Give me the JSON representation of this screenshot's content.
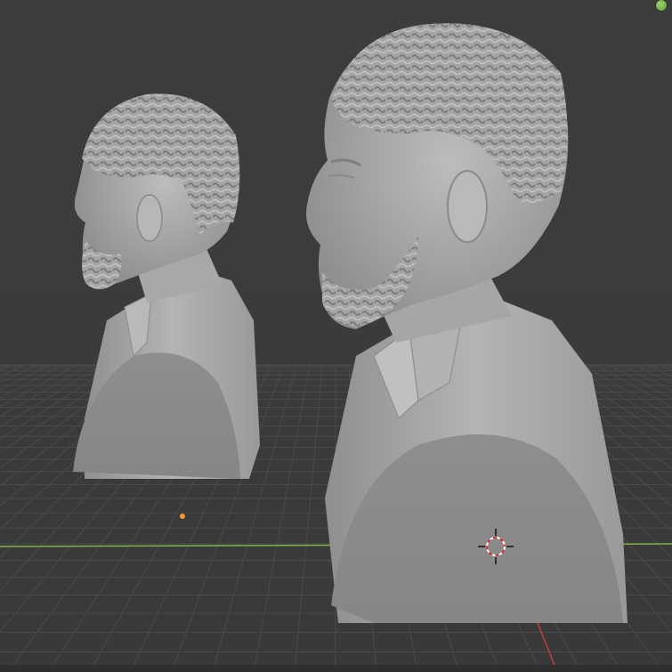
{
  "viewport": {
    "background": "#3b3b3b",
    "grid_color": "#4a4a4a",
    "x_axis_color": "#7fb24a",
    "y_axis_color": "#c04040",
    "model_color": "#a9a9a9",
    "cursor_color_a": "#d9322f",
    "cursor_color_b": "#ffffff",
    "origin_color": "#ff9b2f"
  },
  "objects": [
    {
      "name": "bust-left"
    },
    {
      "name": "bust-right"
    }
  ],
  "gizmo": {
    "icon": "navigation-gizmo-icon",
    "color": "#7fc048"
  },
  "cursor": {
    "icon": "3d-cursor-icon"
  }
}
